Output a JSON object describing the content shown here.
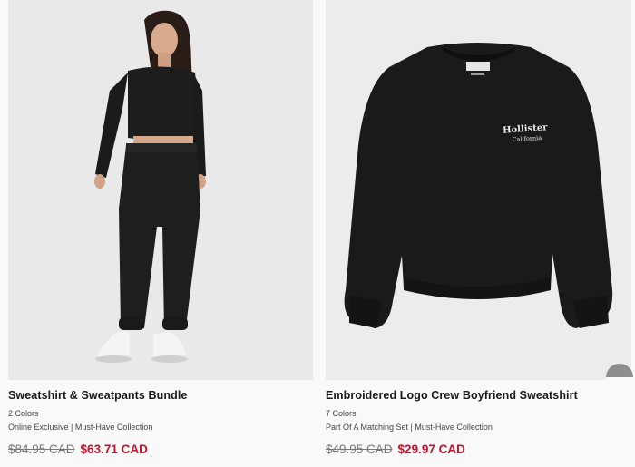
{
  "products": [
    {
      "title": "Sweatshirt & Sweatpants Bundle",
      "colors": "2 Colors",
      "tags": "Online Exclusive | Must-Have Collection",
      "price_original": "$84.95 CAD",
      "price_sale": "$63.71 CAD",
      "image_icon": "model-wearing-black-sweatsuit-image"
    },
    {
      "title": "Embroidered Logo Crew Boyfriend Sweatshirt",
      "colors": "7 Colors",
      "tags": "Part Of A Matching Set | Must-Have Collection",
      "price_original": "$49.95 CAD",
      "price_sale": "$29.97 CAD",
      "image_icon": "black-crew-sweatshirt-image",
      "embroidery_line1": "Hollister",
      "embroidery_line2": "California"
    }
  ],
  "colors": {
    "sale_price": "#c8102e",
    "original_price": "#777777",
    "garment": "#1b1b1b",
    "accent": "#2a6ab0"
  }
}
